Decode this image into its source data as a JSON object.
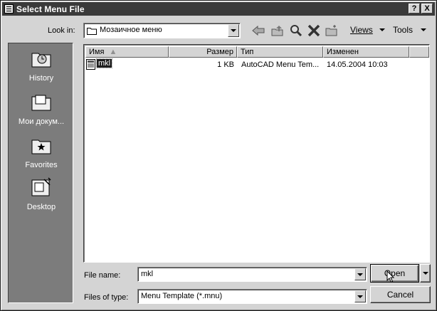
{
  "window": {
    "title": "Select Menu File",
    "help_btn": "?",
    "close_btn": "X"
  },
  "toolbar": {
    "look_in_label": "Look in:",
    "look_in_value": "Мозаичное меню",
    "views_label": "Views",
    "tools_label": "Tools"
  },
  "places": [
    {
      "label": "History",
      "icon": "history-icon"
    },
    {
      "label": "Мои докум...",
      "icon": "my-documents-icon"
    },
    {
      "label": "Favorites",
      "icon": "favorites-icon"
    },
    {
      "label": "Desktop",
      "icon": "desktop-icon"
    }
  ],
  "list": {
    "columns": [
      "Имя",
      "Размер",
      "Тип",
      "Изменен"
    ],
    "rows": [
      {
        "name": "mkl",
        "size": "1 KB",
        "type": "AutoCAD Menu Tem...",
        "modified": "14.05.2004 10:03"
      }
    ]
  },
  "footer": {
    "file_name_label": "File name:",
    "file_name_value": "mkl",
    "file_type_label": "Files of type:",
    "file_type_value": "Menu Template (*.mnu)",
    "open_label": "Open",
    "cancel_label": "Cancel"
  }
}
